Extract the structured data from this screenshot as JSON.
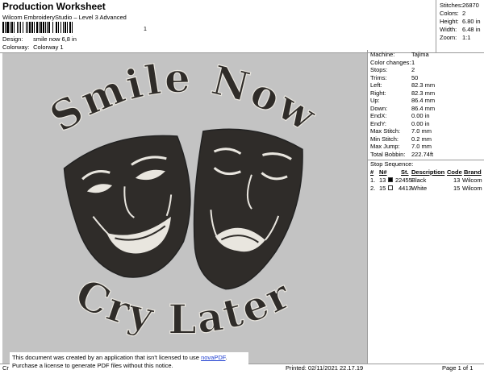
{
  "header": {
    "title": "Production Worksheet",
    "subtitle": "Wilcom EmbroideryStudio – Level 3 Advanced",
    "barcode_suffix": "1",
    "design_label": "Design:",
    "design_value": "smile now 6,8 in",
    "colorway_label": "Colorway:",
    "colorway_value": "Colorway 1"
  },
  "top_stats": [
    {
      "label": "Stitches:",
      "value": "26870"
    },
    {
      "label": "Colors:",
      "value": "2"
    },
    {
      "label": "Height:",
      "value": "6.80 in"
    },
    {
      "label": "Width:",
      "value": "6.48 in"
    },
    {
      "label": "Zoom:",
      "value": "1:1"
    }
  ],
  "machine": [
    {
      "label": "Machine:",
      "value": "Tajima"
    },
    {
      "label": "Color changes:",
      "value": "1"
    },
    {
      "label": "Stops:",
      "value": "2"
    },
    {
      "label": "Trims:",
      "value": "50"
    },
    {
      "label": "Left:",
      "value": "82.3 mm"
    },
    {
      "label": "Right:",
      "value": "82.3 mm"
    },
    {
      "label": "Up:",
      "value": "86.4 mm"
    },
    {
      "label": "Down:",
      "value": "86.4 mm"
    },
    {
      "label": "EndX:",
      "value": "0.00 in"
    },
    {
      "label": "EndY:",
      "value": "0.00 in"
    },
    {
      "label": "Max Stitch:",
      "value": "7.0 mm"
    },
    {
      "label": "Min Stitch:",
      "value": "0.2 mm"
    },
    {
      "label": "Max Jump:",
      "value": "7.0 mm"
    },
    {
      "label": "Total Bobbin:",
      "value": "222.74ft"
    }
  ],
  "stop_sequence": {
    "title": "Stop Sequence:",
    "headers": {
      "num": "#",
      "n": "N#",
      "st": "St.",
      "desc": "Description",
      "code": "Code",
      "brand": "Brand"
    },
    "rows": [
      {
        "num": "1.",
        "n": "13",
        "swatch": "#000000",
        "st": "22455",
        "desc": "Black",
        "code": "13",
        "brand": "Wilcom"
      },
      {
        "num": "2.",
        "n": "15",
        "swatch": "#ffffff",
        "st": "4413",
        "desc": "White",
        "code": "15",
        "brand": "Wilcom"
      }
    ]
  },
  "artwork": {
    "top_text": "Smile Now",
    "bottom_text": "Cry Later",
    "thread_dark": "#2f2c29",
    "thread_light": "#e9e6df",
    "background": "#c3c3c3"
  },
  "notice": {
    "line1_pre": "This document was created by an application that isn't licensed to use ",
    "link": "novaPDF",
    "line1_post": ".",
    "line2": "Purchase a license to generate PDF files without this notice."
  },
  "footer": {
    "cr": "Cr",
    "printed": "Printed: 02/11/2021 22.17.19",
    "page": "Page 1 of 1"
  }
}
